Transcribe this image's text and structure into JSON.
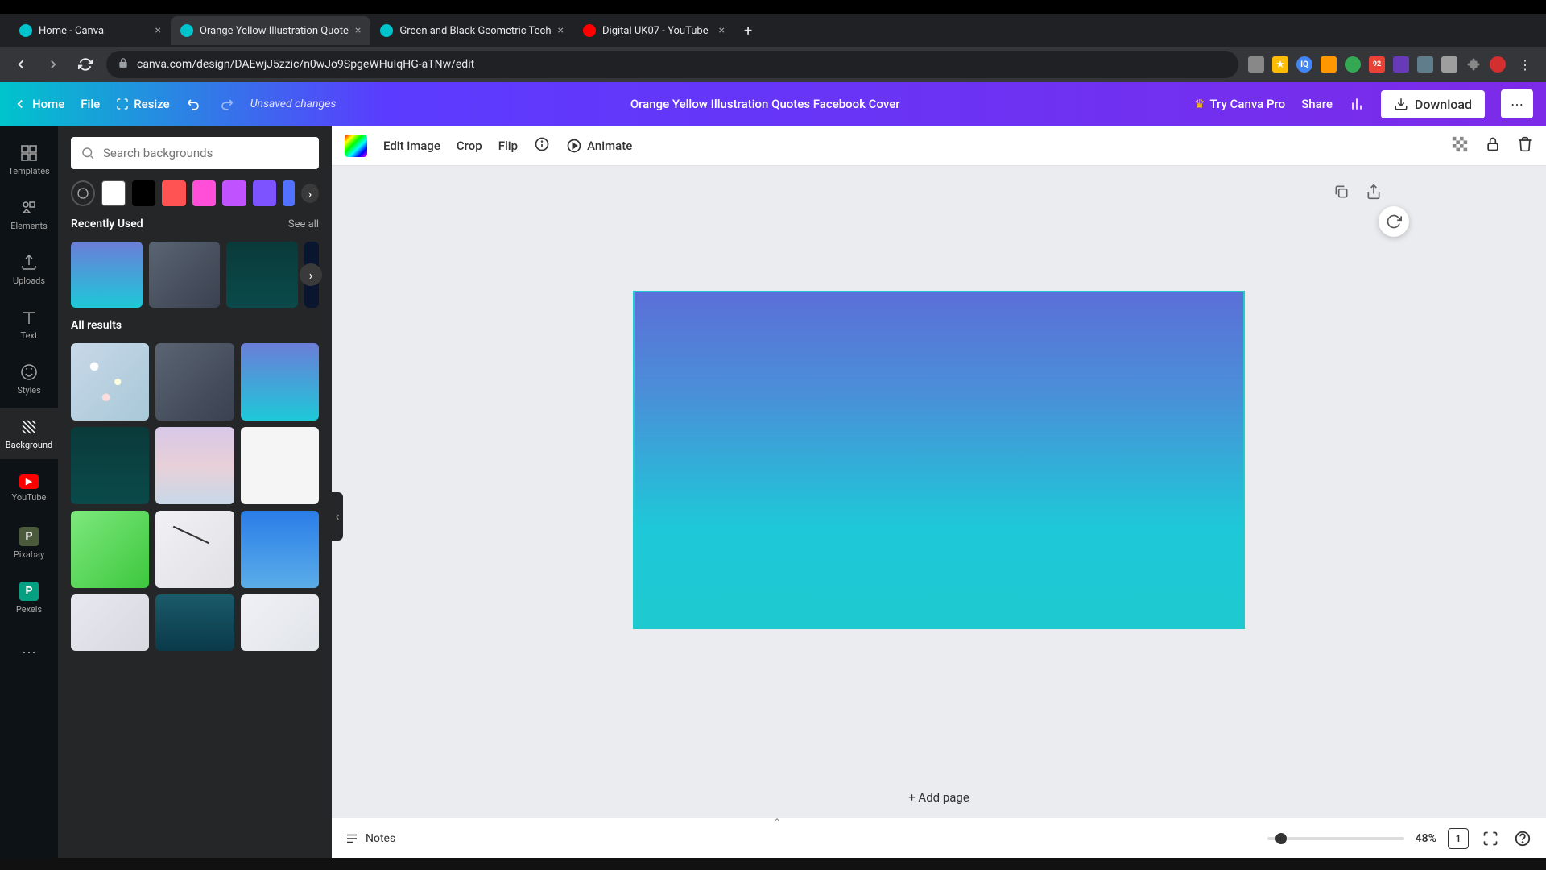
{
  "browser": {
    "tabs": [
      {
        "title": "Home - Canva",
        "faviconColor": "#00c4cc"
      },
      {
        "title": "Orange Yellow Illustration Quote",
        "faviconColor": "#00c4cc"
      },
      {
        "title": "Green and Black Geometric Tech",
        "faviconColor": "#00c4cc"
      },
      {
        "title": "Digital UK07 - YouTube",
        "faviconColor": "#ff0000"
      }
    ],
    "url": "canva.com/design/DAEwjJ5zzic/n0wJo9SpgeWHuIqHG-aTNw/edit"
  },
  "header": {
    "home": "Home",
    "file": "File",
    "resize": "Resize",
    "unsaved": "Unsaved changes",
    "doc_title": "Orange Yellow Illustration Quotes Facebook Cover",
    "try_pro": "Try Canva Pro",
    "share": "Share",
    "download": "Download"
  },
  "farnav": {
    "templates": "Templates",
    "elements": "Elements",
    "uploads": "Uploads",
    "text": "Text",
    "styles": "Styles",
    "background": "Background",
    "youtube": "YouTube",
    "pixabay": "Pixabay",
    "pexels": "Pexels"
  },
  "panel": {
    "search_placeholder": "Search backgrounds",
    "colors": [
      "#ffffff",
      "#000000",
      "#ff5252",
      "#ff4fd8",
      "#c152ff",
      "#7d52ff",
      "#5271ff"
    ],
    "recent_hdr": "Recently Used",
    "see_all": "See all",
    "all_results": "All results"
  },
  "toolbar": {
    "edit_image": "Edit image",
    "crop": "Crop",
    "flip": "Flip",
    "animate": "Animate"
  },
  "canvas": {
    "add_page": "+ Add page"
  },
  "bottom": {
    "notes": "Notes",
    "zoom": "48%",
    "page_num": "1"
  }
}
